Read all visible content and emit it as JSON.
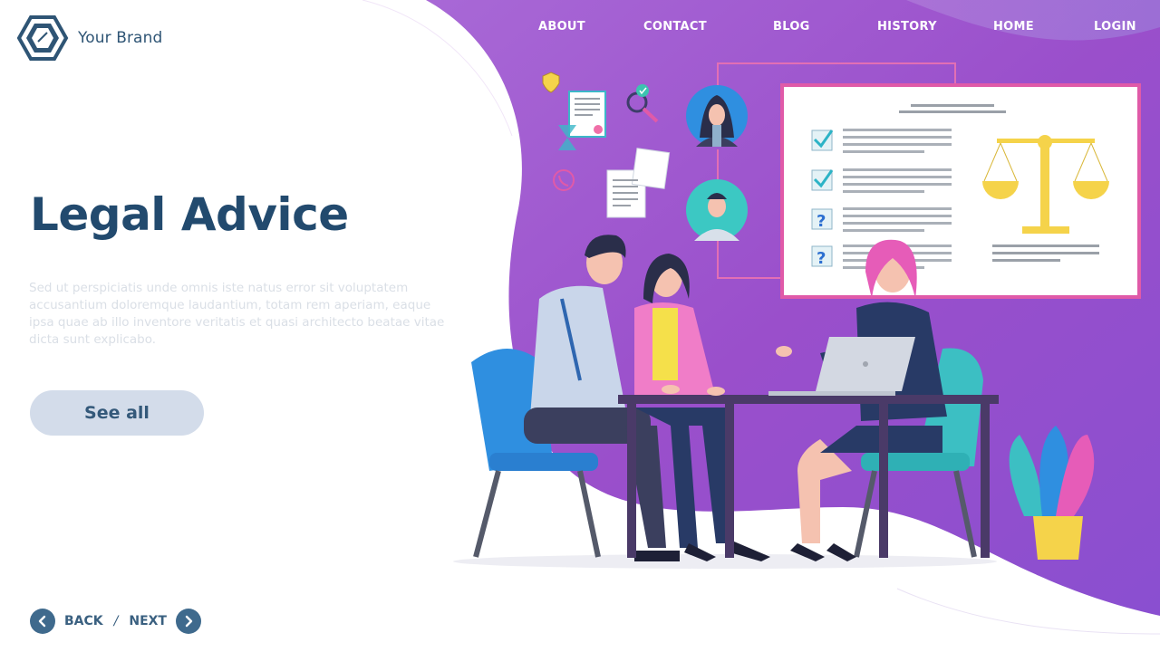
{
  "brand": {
    "name": "Your Brand",
    "logo_icon": "hexagon-logo-icon"
  },
  "nav": {
    "items": [
      {
        "label": "ABOUT"
      },
      {
        "label": "CONTACT"
      },
      {
        "label": "BLOG"
      },
      {
        "label": "HISTORY"
      },
      {
        "label": "HOME"
      },
      {
        "label": "LOGIN"
      }
    ]
  },
  "hero": {
    "title": "Legal Advice",
    "description": "Sed ut perspiciatis unde omnis iste natus error sit voluptatem accusantium doloremque laudantium, totam rem aperiam, eaque ipsa quae ab illo inventore veritatis et quasi architecto beatae vitae dicta sunt explicabo.",
    "cta_label": "See all"
  },
  "pager": {
    "back_label": "BACK",
    "separator": "/",
    "next_label": "NEXT",
    "back_icon": "chevron-left-icon",
    "next_icon": "chevron-right-icon"
  },
  "colors": {
    "accent_purple": "#9b59c9",
    "accent_purple_light": "#b58ee0",
    "title_navy": "#224a6e",
    "button_bg": "#d3dcea",
    "board_border": "#e05aa8"
  },
  "illustration": {
    "icons": [
      "shield-icon",
      "certificate-icon",
      "hourglass-icon",
      "magnifier-check-icon",
      "phone-icon",
      "documents-icon",
      "avatar-woman-icon",
      "avatar-man-icon",
      "checkbox-checked-icon",
      "question-box-icon",
      "scales-of-justice-icon",
      "laptop-icon",
      "plant-pot-icon"
    ]
  }
}
